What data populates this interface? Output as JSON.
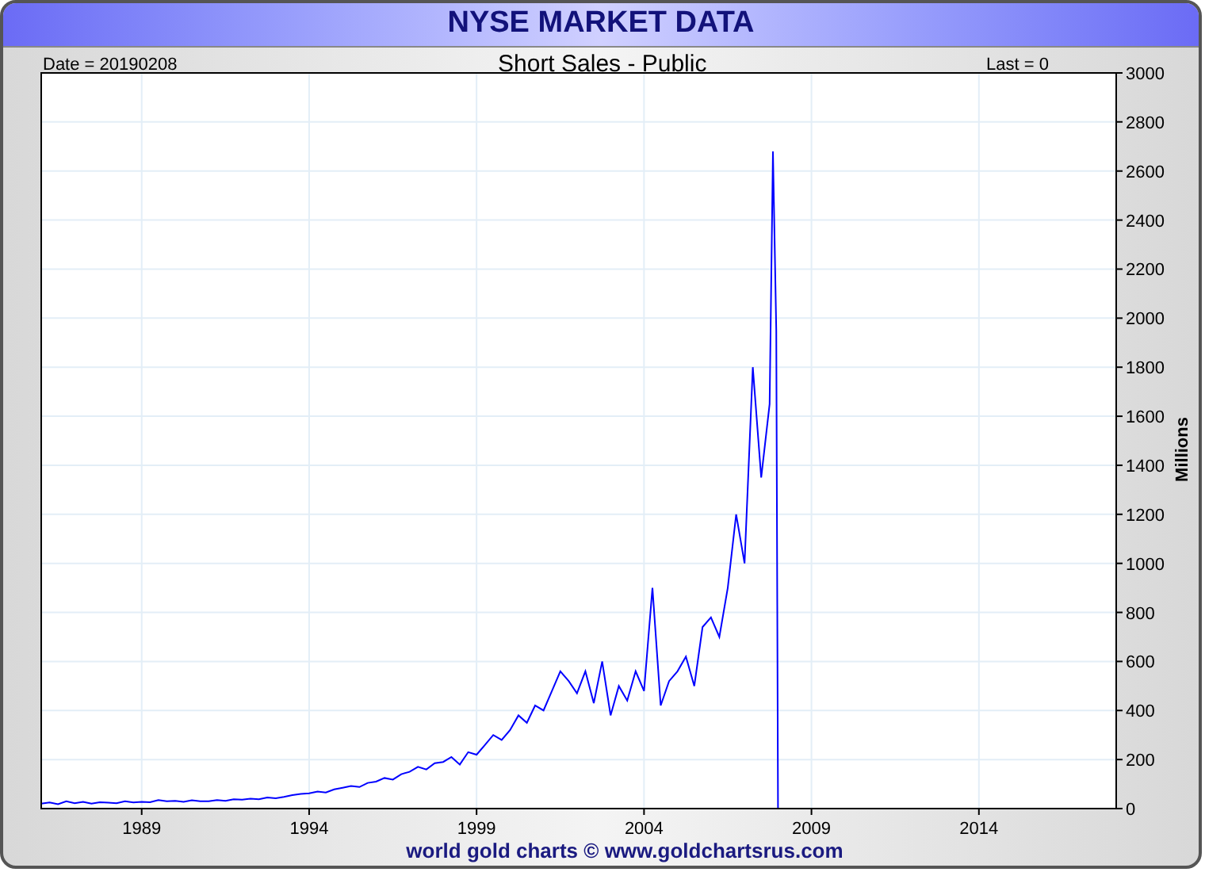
{
  "header": {
    "title": "NYSE MARKET DATA"
  },
  "chart_info": {
    "date": "Date = 20190208",
    "last": "Last = 0"
  },
  "chart": {
    "chart_data": {
      "type": "line",
      "title": "Short Sales - Public",
      "ylabel": "Millions",
      "xlim": [
        1986,
        2018.1
      ],
      "ylim": [
        0,
        3000
      ],
      "xticks": [
        1989,
        1994,
        1999,
        2004,
        2009,
        2014
      ],
      "yticks": [
        0,
        200,
        400,
        600,
        800,
        1000,
        1200,
        1400,
        1600,
        1800,
        2000,
        2200,
        2400,
        2600,
        2800,
        3000
      ],
      "x": [
        1986,
        1986.25,
        1986.5,
        1986.75,
        1987,
        1987.25,
        1987.5,
        1987.75,
        1988,
        1988.25,
        1988.5,
        1988.75,
        1989,
        1989.25,
        1989.5,
        1989.75,
        1990,
        1990.25,
        1990.5,
        1990.75,
        1991,
        1991.25,
        1991.5,
        1991.75,
        1992,
        1992.25,
        1992.5,
        1992.75,
        1993,
        1993.25,
        1993.5,
        1993.75,
        1994,
        1994.25,
        1994.5,
        1994.75,
        1995,
        1995.25,
        1995.5,
        1995.75,
        1996,
        1996.25,
        1996.5,
        1996.75,
        1997,
        1997.25,
        1997.5,
        1997.75,
        1998,
        1998.25,
        1998.5,
        1998.75,
        1999,
        1999.25,
        1999.5,
        1999.75,
        2000,
        2000.25,
        2000.5,
        2000.75,
        2001,
        2001.25,
        2001.5,
        2001.75,
        2002,
        2002.25,
        2002.5,
        2002.75,
        2003,
        2003.25,
        2003.5,
        2003.75,
        2004,
        2004.25,
        2004.5,
        2004.75,
        2005,
        2005.25,
        2005.5,
        2005.75,
        2006,
        2006.25,
        2006.5,
        2006.75,
        2007,
        2007.25,
        2007.5,
        2007.75,
        2007.85,
        2007.95,
        2008
      ],
      "grid": true,
      "series": [
        {
          "color": "#0000ff",
          "values": [
            20,
            25,
            18,
            30,
            22,
            28,
            20,
            26,
            24,
            22,
            30,
            25,
            28,
            26,
            35,
            30,
            32,
            28,
            34,
            30,
            30,
            35,
            32,
            38,
            36,
            40,
            38,
            45,
            42,
            48,
            55,
            60,
            62,
            70,
            65,
            78,
            85,
            92,
            88,
            105,
            110,
            125,
            118,
            140,
            150,
            170,
            160,
            185,
            190,
            210,
            180,
            230,
            220,
            260,
            300,
            280,
            320,
            380,
            350,
            420,
            400,
            480,
            560,
            520,
            470,
            560,
            430,
            600,
            380,
            500,
            440,
            560,
            480,
            900,
            420,
            520,
            560,
            620,
            500,
            740,
            780,
            700,
            900,
            1200,
            1000,
            1800,
            1350,
            1650,
            2680,
            1950,
            0
          ]
        }
      ]
    }
  },
  "footer": {
    "credit": "world gold charts © www.goldchartsrus.com"
  }
}
